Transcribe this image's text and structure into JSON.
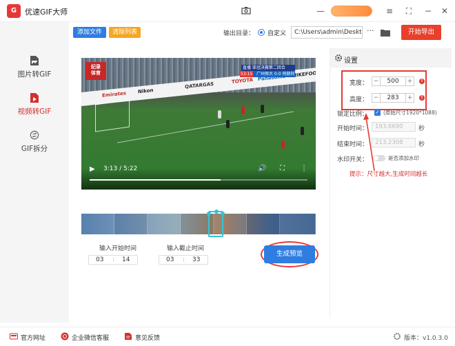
{
  "titlebar": {
    "logo_text": "G",
    "app_title": "优速GIF大师",
    "icon_names": [
      "camera-icon",
      "minus-icon",
      "menu-icon",
      "fullscreen-icon",
      "close-icon"
    ]
  },
  "sidebar": {
    "items": [
      {
        "label": "图片转GIF",
        "icon": "image-file-icon"
      },
      {
        "label": "视频转GIF",
        "icon": "video-file-icon",
        "active": true
      },
      {
        "label": "GIF拆分",
        "icon": "split-icon"
      }
    ]
  },
  "toolbar": {
    "add_file_label": "添加文件",
    "clear_list_label": "清除列表",
    "output_dir_label": "输出目录：",
    "custom_label": "自定义",
    "output_path_value": "C:\\Users\\admin\\Deskto",
    "more_label": "···",
    "export_label": "开始导出",
    "accent_blue": "#2f7de1",
    "accent_orange": "#f5a623",
    "export_red": "#e8402a"
  },
  "video": {
    "current_time": "3:13",
    "duration": "5:22",
    "time_display": "3:13 / 5:22",
    "progress_fraction": 0.6,
    "badge_text": "纪录\n体育",
    "score_top": "直播  亚冠决赛第二回合",
    "score_bottom": "广州恒大 0:0 阿赫利",
    "score_time": "53:15",
    "ads": [
      "Emirates",
      "Nikon",
      "QATARGAS",
      "TOYOTA",
      "Panasonic",
      "NIKEFOOT"
    ]
  },
  "trim": {
    "start_label": "输入开始时间",
    "end_label": "输入截止时间",
    "start_min": "03",
    "start_sec": "14",
    "end_min": "03",
    "end_sec": "33",
    "separator": ":",
    "preview_label": "生成预览"
  },
  "settings": {
    "title": "设置",
    "width_label": "宽度：",
    "width_value": "500",
    "height_label": "高度：",
    "height_value": "283",
    "lock_label": "锁定比例：",
    "original_size": "(原始尺寸1920*1088)",
    "start_time_label": "开始时间：",
    "start_time_value": "193.6690",
    "end_time_label": "结束时间：",
    "end_time_value": "213.2308",
    "seconds_unit": "秒",
    "watermark_label": "水印开关：",
    "watermark_toggle_label": "是否添加水印",
    "tip": "提示：尺寸越大,生成时间越长",
    "minus": "−",
    "plus": "+",
    "warn": "!"
  },
  "footer": {
    "website_label": "官方网址",
    "wechat_label": "企业微信客服",
    "feedback_label": "意见反馈",
    "version": "版本：v1.0.3.0"
  }
}
